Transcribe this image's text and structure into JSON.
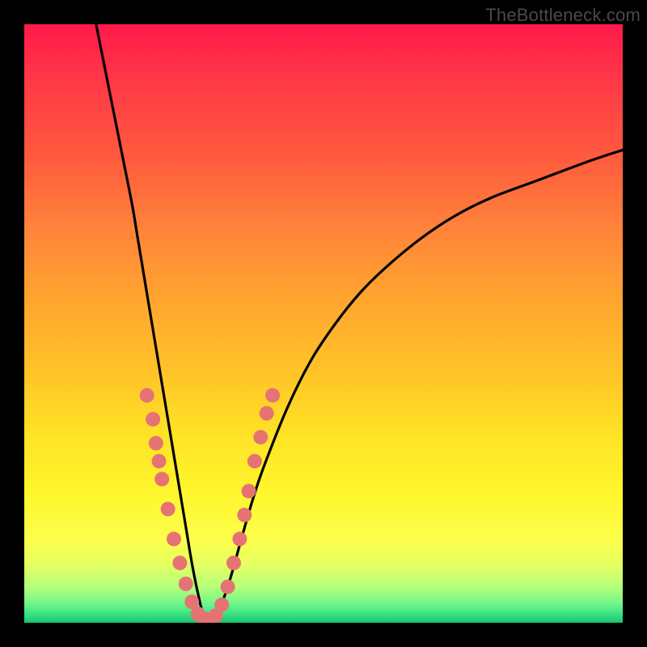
{
  "watermark": "TheBottleneck.com",
  "chart_data": {
    "type": "line",
    "title": "",
    "xlabel": "",
    "ylabel": "",
    "xlim": [
      0,
      100
    ],
    "ylim": [
      0,
      100
    ],
    "grid": false,
    "legend": false,
    "series": [
      {
        "name": "curve",
        "color": "#000000",
        "x": [
          12,
          14,
          16,
          18,
          19,
          20,
          21,
          22,
          23,
          24,
          25,
          26,
          27,
          28,
          29,
          30,
          31,
          32,
          34,
          36,
          38,
          40,
          44,
          48,
          52,
          56,
          60,
          66,
          72,
          78,
          86,
          94,
          100
        ],
        "y": [
          100,
          90,
          80,
          70,
          64,
          58,
          52,
          46,
          40,
          34,
          28,
          22,
          16,
          10,
          5,
          1,
          0,
          1,
          6,
          13,
          20,
          26,
          36,
          44,
          50,
          55,
          59,
          64,
          68,
          71,
          74,
          77,
          79
        ]
      }
    ],
    "dots": {
      "name": "dots",
      "color": "#e57373",
      "radius": 9,
      "points": [
        {
          "x": 20.5,
          "y": 38
        },
        {
          "x": 21.5,
          "y": 34
        },
        {
          "x": 22,
          "y": 30
        },
        {
          "x": 22.5,
          "y": 27
        },
        {
          "x": 23,
          "y": 24
        },
        {
          "x": 24,
          "y": 19
        },
        {
          "x": 25,
          "y": 14
        },
        {
          "x": 26,
          "y": 10
        },
        {
          "x": 27,
          "y": 6.5
        },
        {
          "x": 28,
          "y": 3.5
        },
        {
          "x": 29,
          "y": 1.5
        },
        {
          "x": 30,
          "y": 0.7
        },
        {
          "x": 31,
          "y": 0.5
        },
        {
          "x": 32,
          "y": 1.2
        },
        {
          "x": 33,
          "y": 3
        },
        {
          "x": 34,
          "y": 6
        },
        {
          "x": 35,
          "y": 10
        },
        {
          "x": 36,
          "y": 14
        },
        {
          "x": 36.8,
          "y": 18
        },
        {
          "x": 37.5,
          "y": 22
        },
        {
          "x": 38.5,
          "y": 27
        },
        {
          "x": 39.5,
          "y": 31
        },
        {
          "x": 40.5,
          "y": 35
        },
        {
          "x": 41.5,
          "y": 38
        }
      ]
    },
    "gradient_stops": [
      {
        "pos": 0,
        "color": "#ff1a4a"
      },
      {
        "pos": 50,
        "color": "#ffc328"
      },
      {
        "pos": 85,
        "color": "#fdff4a"
      },
      {
        "pos": 100,
        "color": "#18c470"
      }
    ]
  }
}
